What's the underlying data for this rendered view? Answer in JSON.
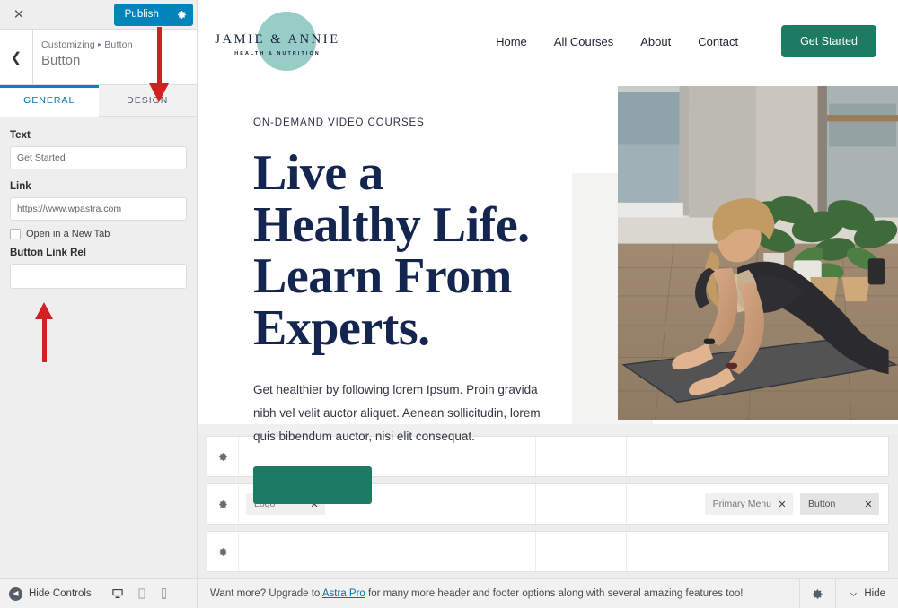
{
  "customizer": {
    "close_icon": "close-icon",
    "publish_label": "Publish",
    "publish_gear_icon": "gear-icon",
    "back_icon": "chevron-left-icon",
    "breadcrumb_root": "Customizing",
    "breadcrumb_sep": "▸",
    "breadcrumb_current": "Button",
    "panel_title": "Button",
    "tabs": [
      {
        "label": "GENERAL",
        "active": true
      },
      {
        "label": "DESIGN",
        "active": false
      }
    ],
    "fields": {
      "text_label": "Text",
      "text_value": "Get Started",
      "link_label": "Link",
      "link_value": "https://www.wpastra.com",
      "newtab_label": "Open in a New Tab",
      "newtab_checked": false,
      "rel_label": "Button Link Rel",
      "rel_value": ""
    },
    "annotations": {
      "arrow_design_name": "red-arrow-pointing-to-design-tab",
      "arrow_field_name": "red-arrow-pointing-to-button-link-rel-field",
      "arrow_color": "#d32020"
    }
  },
  "preview": {
    "site": {
      "logo_name": "JAMIE & ANNIE",
      "logo_sub": "HEALTH & NUTRITION",
      "logo_circle_color": "#8ec8c2",
      "nav": [
        {
          "label": "Home"
        },
        {
          "label": "All Courses"
        },
        {
          "label": "About"
        },
        {
          "label": "Contact"
        }
      ],
      "cta_label": "Get Started",
      "cta_color": "#1d7a63"
    },
    "hero": {
      "eyebrow": "ON-DEMAND VIDEO COURSES",
      "heading_line1": "Live a",
      "heading_line2": "Healthy Life.",
      "heading_line3": "Learn From",
      "heading_line4": "Experts.",
      "heading_color": "#14254f",
      "paragraph": "Get healthier by following lorem Ipsum. Proin gravida nibh vel velit auctor aliquet. Aenean sollicitudin, lorem quis bibendum auctor, nisi elit consequat.",
      "button_color": "#1d7a63",
      "image_alt": "woman-doing-yoga-lunge-pose-on-mat-with-plants"
    }
  },
  "builder": {
    "rows": [
      {
        "name": "above-header-row",
        "gear_icon": "gear-icon",
        "columns": [
          {
            "items": []
          },
          {
            "items": []
          },
          {
            "items": []
          }
        ]
      },
      {
        "name": "primary-header-row",
        "gear_icon": "gear-icon",
        "columns": [
          {
            "items": [
              {
                "label": "Logo",
                "selected": false,
                "remove_icon": "close-icon"
              }
            ]
          },
          {
            "items": []
          },
          {
            "items": [
              {
                "label": "Primary Menu",
                "selected": false,
                "remove_icon": "close-icon"
              },
              {
                "label": "Button",
                "selected": true,
                "remove_icon": "close-icon"
              }
            ]
          }
        ]
      },
      {
        "name": "below-header-row",
        "gear_icon": "gear-icon",
        "columns": [
          {
            "items": []
          },
          {
            "items": []
          },
          {
            "items": []
          }
        ]
      }
    ]
  },
  "bottombar": {
    "hide_controls_label": "Hide Controls",
    "devices": [
      {
        "name": "desktop-view",
        "active": true
      },
      {
        "name": "tablet-view",
        "active": false
      },
      {
        "name": "mobile-view",
        "active": false
      }
    ],
    "note_prefix": "Want more? Upgrade to ",
    "note_link": "Astra Pro",
    "note_suffix": " for many more header and footer options along with several amazing features too!",
    "gear_icon": "gear-icon",
    "hide_label": "Hide",
    "hide_chevron_icon": "chevron-down-icon"
  }
}
